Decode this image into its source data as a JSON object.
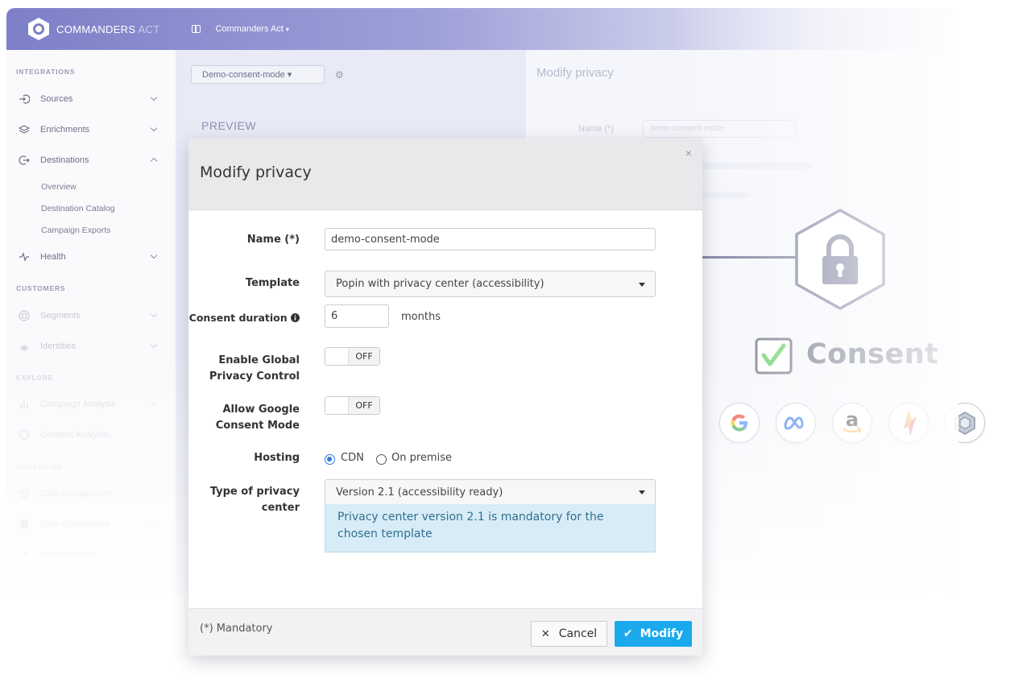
{
  "topbar": {
    "brand_main": "COMMANDERS",
    "brand_sub": "ACT",
    "account_label": "Commanders Act",
    "account_caret": "▾"
  },
  "sidebar": {
    "sections": {
      "integrations": "INTEGRATIONS",
      "customers": "CUSTOMERS",
      "explore": "EXPLORE",
      "configure": "CONFIGURE"
    },
    "items": {
      "sources": "Sources",
      "enrichments": "Enrichments",
      "destinations": "Destinations",
      "overview": "Overview",
      "destination_catalog": "Destination Catalog",
      "campaign_exports": "Campaign Exports",
      "health": "Health",
      "segments": "Segments",
      "identities": "Identities",
      "campaign_analysis": "Campaign Analysis",
      "consent_analysis": "Consent Analysis",
      "data_management": "Data Management",
      "data_governance": "Data Governance",
      "administration": "Administration"
    }
  },
  "background": {
    "site_dropdown": "Demo-consent-mode ▾",
    "preview_heading": "PREVIEW",
    "right_title": "Modify privacy",
    "right_name_label": "Name (*)",
    "right_name_value": "demo-consent-mode"
  },
  "modal": {
    "title": "Modify privacy",
    "close": "×",
    "fields": {
      "name_label": "Name (*)",
      "name_value": "demo-consent-mode",
      "template_label": "Template",
      "template_value": "Popin with privacy center (accessibility)",
      "duration_label": "Consent duration",
      "duration_value": "6",
      "duration_unit": "months",
      "gpc_label_1": "Enable Global",
      "gpc_label_2": "Privacy Control",
      "gpc_state": "OFF",
      "gcm_label_1": "Allow Google",
      "gcm_label_2": "Consent Mode",
      "gcm_state": "OFF",
      "hosting_label": "Hosting",
      "hosting_options": [
        "CDN",
        "On premise"
      ],
      "hosting_selected": "CDN",
      "privacy_type_label_1": "Type of privacy",
      "privacy_type_label_2": "center",
      "privacy_type_value": "Version 2.1 (accessibility ready)",
      "privacy_info": "Privacy center version 2.1 is mandatory for the chosen template"
    },
    "footer": {
      "mandatory_note": "(*) Mandatory",
      "cancel_label": "Cancel",
      "modify_label": "Modify"
    }
  },
  "illustration": {
    "consent_label": "Consent",
    "partners": [
      "google-icon",
      "meta-icon",
      "amazon-icon",
      "campaign-manager-icon",
      "cube-icon"
    ]
  },
  "colors": {
    "accent": "#1aa9ec",
    "topbar": "#7d7fc8",
    "info_bg": "#d8ecf7",
    "info_text": "#31708f",
    "consent_check": "#6ccf6a"
  }
}
